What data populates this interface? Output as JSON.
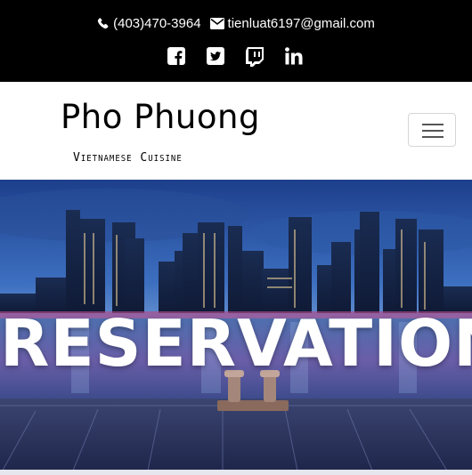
{
  "topbar": {
    "phone": "(403)470-3964",
    "email": "tienluat6197@gmail.com",
    "social": [
      {
        "name": "facebook",
        "icon": "facebook-icon"
      },
      {
        "name": "twitter",
        "icon": "twitter-icon"
      },
      {
        "name": "twitch",
        "icon": "twitch-icon"
      },
      {
        "name": "linkedin",
        "icon": "linkedin-icon"
      }
    ]
  },
  "brand": {
    "name": "Pho Phuong",
    "tagline": "Vietnamese Cuisine"
  },
  "navbar": {
    "toggler_icon": "hamburger-menu-icon"
  },
  "hero": {
    "title": "RESERVATION"
  },
  "colors": {
    "topbar_bg": "#000000",
    "text_on_dark": "#ffffff",
    "toggler_border": "#d6d6d6"
  }
}
